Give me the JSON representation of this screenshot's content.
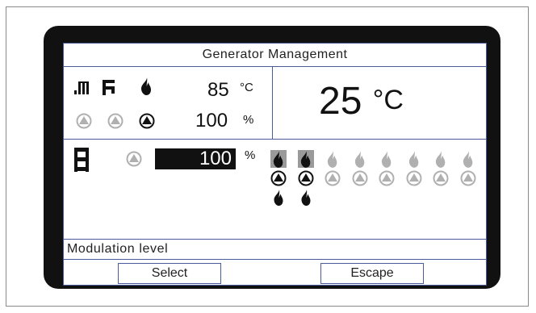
{
  "title": "Generator Management",
  "header": {
    "icons": [
      "radiator-icon",
      "tap-icon",
      "flame-icon"
    ],
    "pumps": [
      "pump-inactive",
      "pump-inactive",
      "pump-active"
    ],
    "temp_value": "85",
    "temp_unit": "°C",
    "mod_value": "100",
    "mod_unit": "%"
  },
  "setpoint": {
    "value": "25",
    "unit": "°C"
  },
  "generator": {
    "icon": "boiler-ladder-icon",
    "pump": "pump-inactive",
    "modulation_value": "100",
    "modulation_unit": "%"
  },
  "stages": [
    {
      "flame": "active-boxed",
      "pump": "active",
      "lower_flame": true
    },
    {
      "flame": "active-boxed",
      "pump": "active",
      "lower_flame": true
    },
    {
      "flame": "inactive",
      "pump": "inactive",
      "lower_flame": false
    },
    {
      "flame": "inactive",
      "pump": "inactive",
      "lower_flame": false
    },
    {
      "flame": "inactive",
      "pump": "inactive",
      "lower_flame": false
    },
    {
      "flame": "inactive",
      "pump": "inactive",
      "lower_flame": false
    },
    {
      "flame": "inactive",
      "pump": "inactive",
      "lower_flame": false
    },
    {
      "flame": "inactive",
      "pump": "inactive",
      "lower_flame": false
    }
  ],
  "status": "Modulation level",
  "softkeys": {
    "select": "Select",
    "escape": "Escape"
  },
  "colors": {
    "bezel": "#111111",
    "divider": "#4a5a9a",
    "active": "#111111",
    "inactive": "#b0b0b0"
  }
}
